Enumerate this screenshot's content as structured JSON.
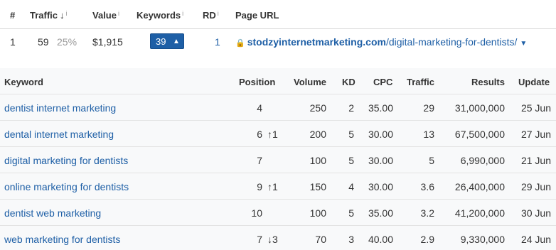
{
  "page_table": {
    "headers": {
      "num": "#",
      "traffic": "Traffic",
      "value": "Value",
      "keywords": "Keywords",
      "rd": "RD",
      "page_url": "Page URL"
    },
    "sort_indicator": "↓",
    "info_mark": "i",
    "row": {
      "num": "1",
      "traffic": "59",
      "traffic_share": "25%",
      "value": "$1,915",
      "keywords": "39",
      "rd": "1",
      "url_domain": "stodzyinternetmarketing.com",
      "url_path": "/digital-marketing-for-dentists/"
    }
  },
  "keyword_table": {
    "headers": {
      "keyword": "Keyword",
      "position": "Position",
      "volume": "Volume",
      "kd": "KD",
      "cpc": "CPC",
      "traffic": "Traffic",
      "results": "Results",
      "update": "Update"
    },
    "rows": [
      {
        "keyword": "dentist internet marketing",
        "position": "4",
        "change": "",
        "volume": "250",
        "kd": "2",
        "cpc": "35.00",
        "traffic": "29",
        "results": "31,000,000",
        "update": "25 Jun"
      },
      {
        "keyword": "dental internet marketing",
        "position": "6",
        "change": "↑1",
        "volume": "200",
        "kd": "5",
        "cpc": "30.00",
        "traffic": "13",
        "results": "67,500,000",
        "update": "27 Jun"
      },
      {
        "keyword": "digital marketing for dentists",
        "position": "7",
        "change": "",
        "volume": "100",
        "kd": "5",
        "cpc": "30.00",
        "traffic": "5",
        "results": "6,990,000",
        "update": "21 Jun"
      },
      {
        "keyword": "online marketing for dentists",
        "position": "9",
        "change": "↑1",
        "volume": "150",
        "kd": "4",
        "cpc": "30.00",
        "traffic": "3.6",
        "results": "26,400,000",
        "update": "29 Jun"
      },
      {
        "keyword": "dentist web marketing",
        "position": "10",
        "change": "",
        "volume": "100",
        "kd": "5",
        "cpc": "35.00",
        "traffic": "3.2",
        "results": "41,200,000",
        "update": "30 Jun"
      },
      {
        "keyword": "web marketing for dentists",
        "position": "7",
        "change": "↓3",
        "volume": "70",
        "kd": "3",
        "cpc": "40.00",
        "traffic": "2.9",
        "results": "9,330,000",
        "update": "24 Jun"
      }
    ]
  },
  "colors": {
    "link": "#1e5fa6",
    "badge": "#1e5fa6",
    "up": "#2e9e3e",
    "down": "#d93025",
    "table_bg": "#f8f9fa"
  }
}
